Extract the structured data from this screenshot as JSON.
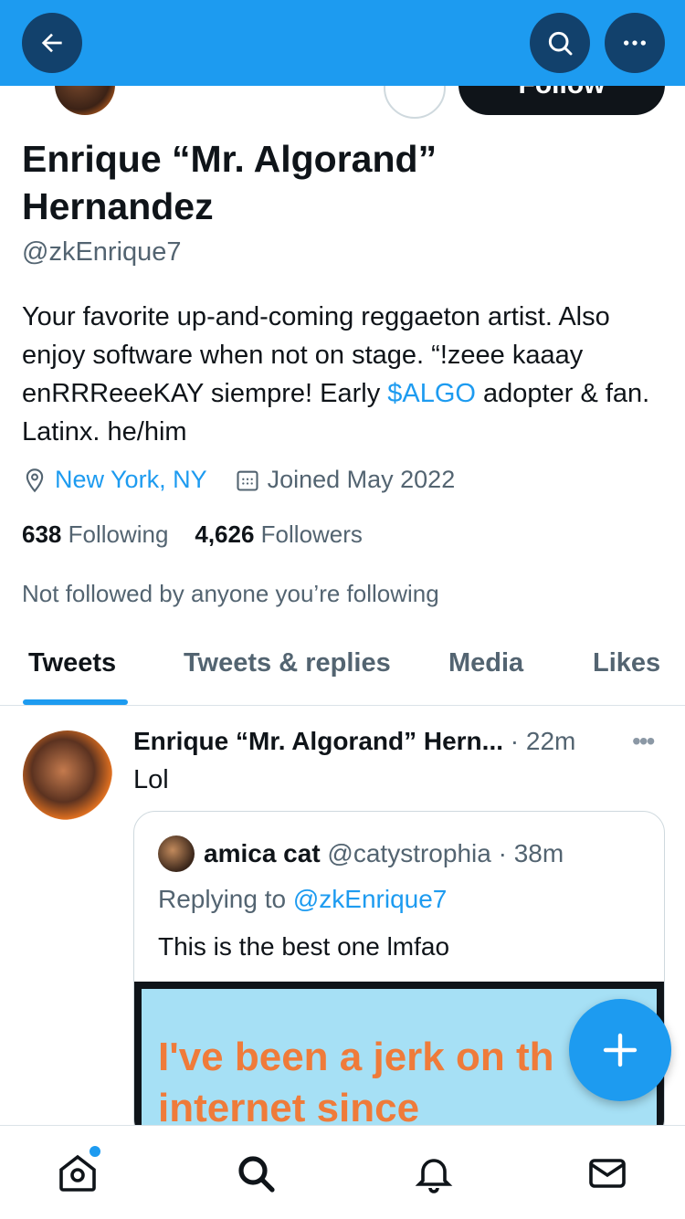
{
  "profile": {
    "name": "Enrique “Mr. Algorand” Hernandez",
    "handle": "@zkEnrique7",
    "follow_label": "Follow",
    "bio_pre": "Your favorite up-and-coming reggaeton artist. Also enjoy software when not on stage. “!zeee kaaay enRRReeeKAY siempre! Early ",
    "bio_link": "$ALGO",
    "bio_post": " adopter & fan. Latinx. he/him",
    "location": "New York, NY",
    "joined": "Joined May 2022",
    "following_count": "638",
    "following_label": "Following",
    "followers_count": "4,626",
    "followers_label": "Followers",
    "not_followed": "Not followed by anyone you’re following"
  },
  "tabs": [
    {
      "label": "Tweets",
      "active": true
    },
    {
      "label": "Tweets & replies",
      "active": false
    },
    {
      "label": "Media",
      "active": false
    },
    {
      "label": "Likes",
      "active": false
    }
  ],
  "tweet": {
    "author": "Enrique “Mr. Algorand” Hern...",
    "time": "· 22m",
    "text": "Lol",
    "quote": {
      "author": "amica cat",
      "meta": "@catystrophia · 38m",
      "replying_prefix": "Replying to ",
      "replying_handle": "@zkEnrique7",
      "text": "This is the best one lmfao",
      "image_line1": "I've been a jerk on th",
      "image_line2": "internet          since"
    }
  },
  "icons": {
    "back": "arrow-left-icon",
    "search": "search-icon",
    "more": "more-icon",
    "compose": "plus-icon",
    "home": "home-icon",
    "explore": "search-icon",
    "notifications": "bell-icon",
    "messages": "mail-icon"
  },
  "colors": {
    "accent": "#1d9bf0",
    "text": "#0f1419",
    "muted": "#536471"
  }
}
